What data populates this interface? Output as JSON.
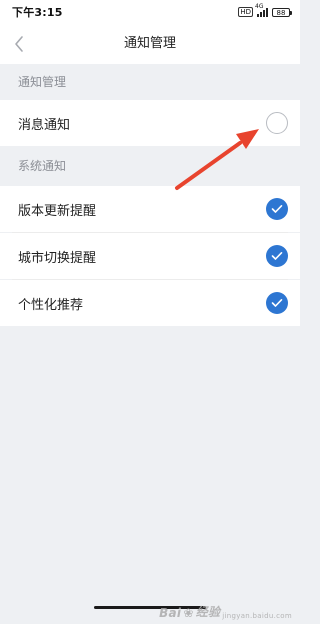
{
  "status_bar": {
    "time": "下午3:15",
    "hd_label": "HD",
    "network_label": "4G",
    "battery": "88"
  },
  "nav": {
    "title": "通知管理"
  },
  "sections": [
    {
      "header": "通知管理",
      "items": [
        {
          "label": "消息通知",
          "checked": false
        }
      ]
    },
    {
      "header": "系统通知",
      "items": [
        {
          "label": "版本更新提醒",
          "checked": true
        },
        {
          "label": "城市切换提醒",
          "checked": true
        },
        {
          "label": "个性化推荐",
          "checked": true
        }
      ]
    }
  ],
  "colors": {
    "accent": "#2d76d2",
    "annotation_arrow": "#e8442e",
    "background": "#eef0f3"
  },
  "watermark": {
    "text": "Bai",
    "paw_glyph": "❀",
    "tail": "经验",
    "sub": "jingyan.baidu.com"
  }
}
